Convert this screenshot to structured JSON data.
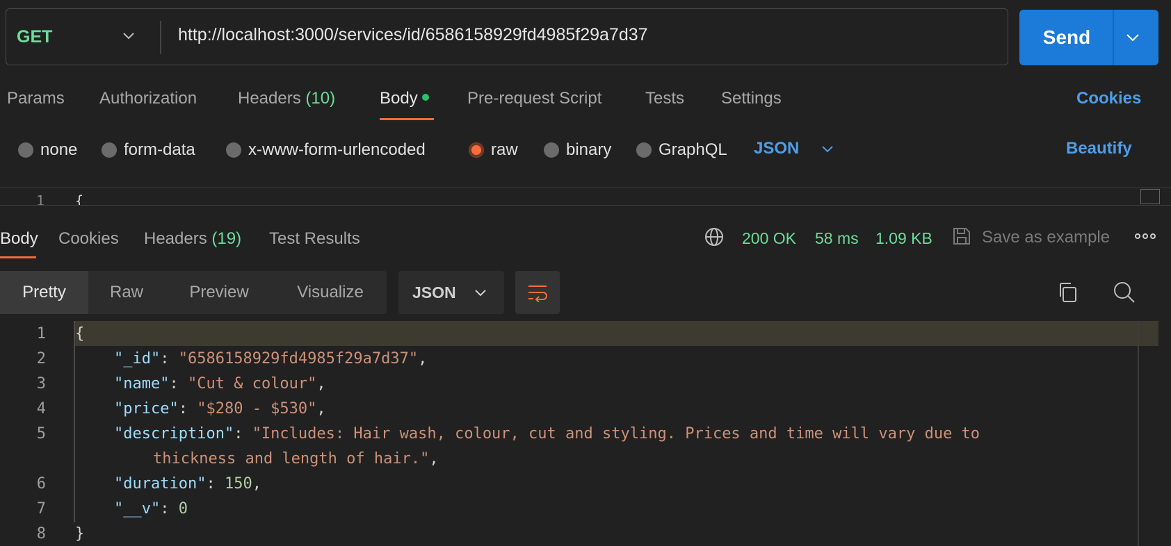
{
  "request": {
    "method": "GET",
    "url": "http://localhost:3000/services/id/6586158929fd4985f29a7d37",
    "send_label": "Send"
  },
  "request_tabs": {
    "params": "Params",
    "authorization": "Authorization",
    "headers": "Headers",
    "headers_count": "(10)",
    "body": "Body",
    "prerequest": "Pre-request Script",
    "tests": "Tests",
    "settings": "Settings",
    "cookies": "Cookies"
  },
  "body_types": {
    "none": "none",
    "form_data": "form-data",
    "urlencoded": "x-www-form-urlencoded",
    "raw": "raw",
    "binary": "binary",
    "graphql": "GraphQL",
    "selected": "raw",
    "format": "JSON",
    "beautify": "Beautify"
  },
  "request_editor": {
    "line1_num": "1",
    "line1_text": "{"
  },
  "response_tabs": {
    "body": "Body",
    "cookies": "Cookies",
    "headers": "Headers",
    "headers_count": "(19)",
    "test_results": "Test Results"
  },
  "response_status": {
    "status": "200 OK",
    "time": "58 ms",
    "size": "1.09 KB",
    "save_as_example": "Save as example"
  },
  "viewer": {
    "pretty": "Pretty",
    "raw": "Raw",
    "preview": "Preview",
    "visualize": "Visualize",
    "format": "JSON",
    "active": "Pretty"
  },
  "response_body": {
    "line_numbers": [
      "1",
      "2",
      "3",
      "4",
      "5",
      "",
      "6",
      "7",
      "8"
    ],
    "open_brace": "{",
    "close_brace": "}",
    "id_key": "\"_id\"",
    "id_value": "\"6586158929fd4985f29a7d37\"",
    "name_key": "\"name\"",
    "name_value": "\"Cut & colour\"",
    "price_key": "\"price\"",
    "price_value": "\"$280 - $530\"",
    "description_key": "\"description\"",
    "description_value_1": "\"Includes: Hair wash, colour, cut and styling. Prices and time will vary due to",
    "description_value_2": "thickness and length of hair.\"",
    "duration_key": "\"duration\"",
    "duration_value": "150",
    "v_key": "\"__v\"",
    "v_value": "0"
  },
  "icons": {
    "method_dropdown": "chevron-down-icon",
    "send_dropdown": "chevron-down-icon",
    "format_dropdown": "chevron-down-icon",
    "globe": "globe-icon",
    "save": "save-icon",
    "more": "more-icon",
    "wrap": "wrap-lines-icon",
    "copy": "copy-icon",
    "search": "search-icon"
  },
  "colors": {
    "accent_orange": "#ff6c37",
    "send_blue": "#1c7ad8",
    "link_blue": "#4d9ee9",
    "success_green": "#6bdd9a"
  }
}
